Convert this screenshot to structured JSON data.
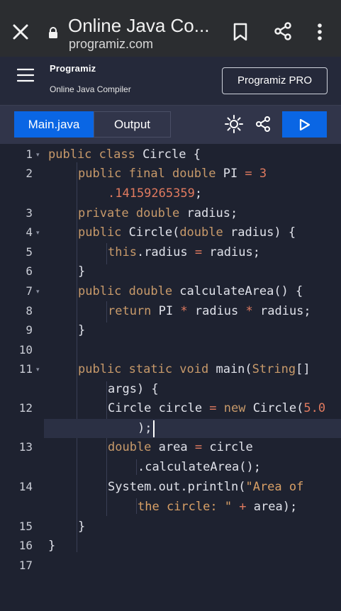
{
  "browser": {
    "title": "Online Java Co...",
    "url": "programiz.com"
  },
  "site": {
    "brand": "Programiz",
    "subtitle": "Online Java Compiler",
    "pro_button": "Programiz PRO"
  },
  "tabs": {
    "main": "Main.java",
    "output": "Output"
  },
  "editor": {
    "line_numbers": [
      "1",
      "2",
      "3",
      "4",
      "5",
      "6",
      "7",
      "8",
      "9",
      "10",
      "11",
      "12",
      "13",
      "14",
      "15",
      "16",
      "17"
    ],
    "lines": [
      [
        [
          "kw",
          "public class "
        ],
        [
          "t",
          "Circle {"
        ]
      ],
      [
        [
          "kw",
          "public final double "
        ],
        [
          "t",
          "PI "
        ],
        [
          "op",
          "= "
        ],
        [
          "num",
          "3"
        ]
      ],
      [
        [
          "num",
          ".14159265359"
        ],
        [
          "t",
          ";"
        ]
      ],
      [
        [
          "kw",
          "private double "
        ],
        [
          "t",
          "radius;"
        ]
      ],
      [
        [
          "kw",
          "public "
        ],
        [
          "t",
          "Circle("
        ],
        [
          "kw",
          "double "
        ],
        [
          "t",
          "radius) {"
        ]
      ],
      [
        [
          "kw",
          "this"
        ],
        [
          "t",
          ".radius "
        ],
        [
          "op",
          "= "
        ],
        [
          "t",
          "radius;"
        ]
      ],
      [
        [
          "t",
          "}"
        ]
      ],
      [
        [
          "kw",
          "public double "
        ],
        [
          "t",
          "calculateArea() {"
        ]
      ],
      [
        [
          "kw",
          "return "
        ],
        [
          "t",
          "PI "
        ],
        [
          "op",
          "* "
        ],
        [
          "t",
          "radius "
        ],
        [
          "op",
          "* "
        ],
        [
          "t",
          "radius;"
        ]
      ],
      [
        [
          "t",
          "}"
        ]
      ],
      [
        [
          "kw",
          "public static void "
        ],
        [
          "t",
          "main("
        ],
        [
          "kw",
          "String"
        ],
        [
          "t",
          "[]"
        ]
      ],
      [
        [
          "t",
          "args) {"
        ]
      ],
      [
        [
          "t",
          "Circle circle "
        ],
        [
          "op",
          "= "
        ],
        [
          "kw",
          "new "
        ],
        [
          "t",
          "Circle("
        ],
        [
          "num",
          "5.0"
        ]
      ],
      [
        [
          "t",
          ");"
        ]
      ],
      [
        [
          "kw",
          "double "
        ],
        [
          "t",
          "area "
        ],
        [
          "op",
          "= "
        ],
        [
          "t",
          "circle"
        ]
      ],
      [
        [
          "t",
          ".calculateArea();"
        ]
      ],
      [
        [
          "t",
          "System.out.println("
        ],
        [
          "str",
          "\"Area of"
        ]
      ],
      [
        [
          "str",
          "the circle: \" "
        ],
        [
          "op",
          "+ "
        ],
        [
          "t",
          "area);"
        ]
      ],
      [
        [
          "t",
          "}"
        ]
      ],
      [
        [
          "t",
          "}"
        ]
      ]
    ]
  },
  "colors": {
    "accent": "#0a66e4",
    "keyword": "#c89a6a",
    "number": "#e07a5f",
    "background": "#1e2230"
  }
}
